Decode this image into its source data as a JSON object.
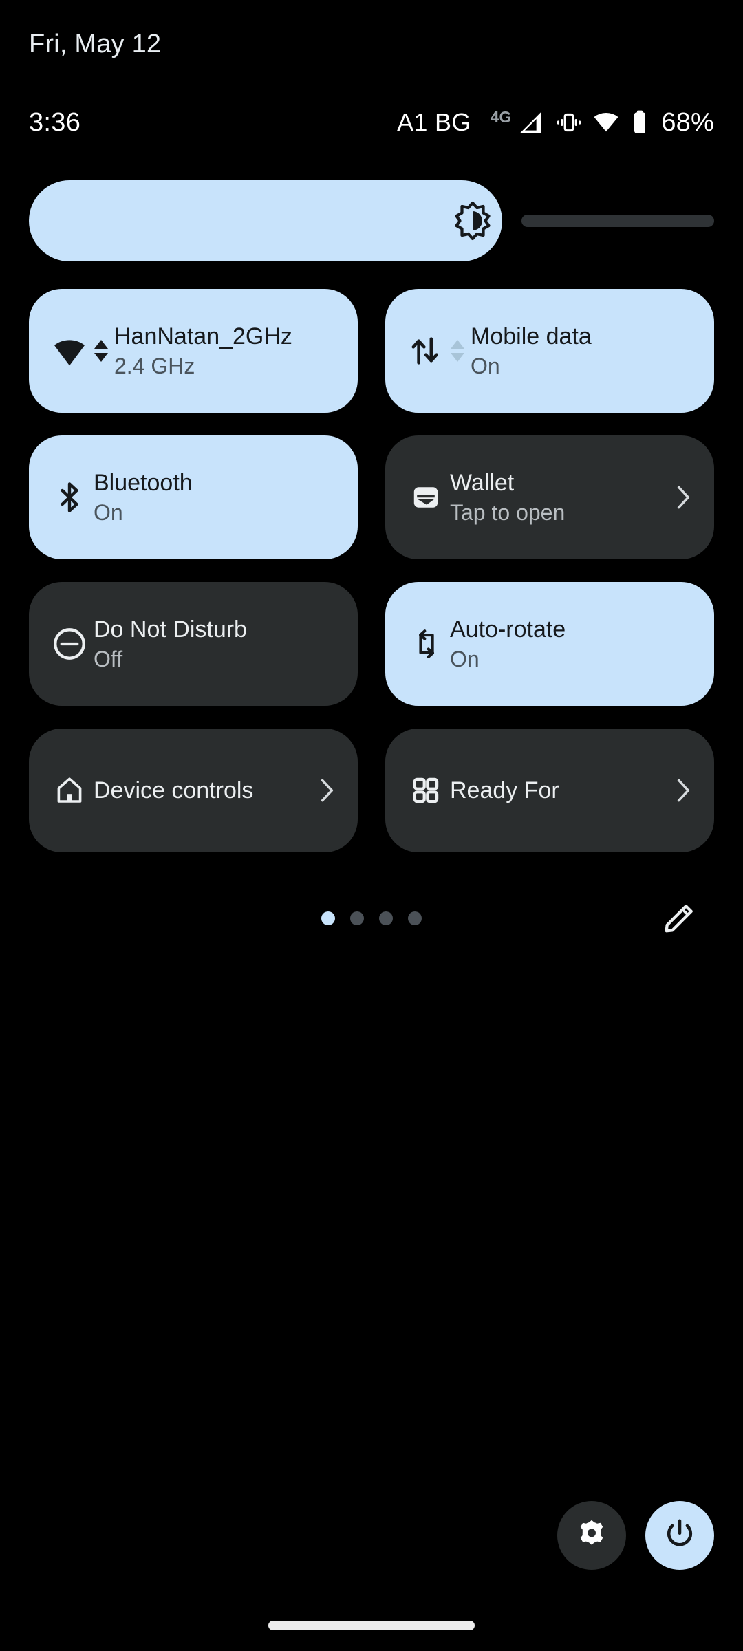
{
  "header": {
    "date": "Fri, May 12"
  },
  "status_bar": {
    "clock": "3:36",
    "carrier": "A1 BG",
    "network_type": "4G",
    "battery_percent": "68%",
    "icons": {
      "signal": "signal-bars-icon",
      "vibrate": "vibrate-icon",
      "wifi": "wifi-icon",
      "battery": "battery-icon"
    }
  },
  "brightness": {
    "name": "brightness-slider",
    "icon": "brightness-icon",
    "value_percent": 69
  },
  "tiles": [
    {
      "id": "wifi",
      "title": "HanNatan_2GHz",
      "subtitle": "2.4 GHz",
      "state": "active",
      "icon": "wifi-icon",
      "activity_arrows": "active",
      "chevron": false
    },
    {
      "id": "mobile-data",
      "title": "Mobile data",
      "subtitle": "On",
      "state": "active",
      "icon": "data-transfer-icon",
      "activity_arrows": "dim",
      "chevron": false
    },
    {
      "id": "bluetooth",
      "title": "Bluetooth",
      "subtitle": "On",
      "state": "active",
      "icon": "bluetooth-icon",
      "activity_arrows": "none",
      "chevron": false
    },
    {
      "id": "wallet",
      "title": "Wallet",
      "subtitle": "Tap to open",
      "state": "inactive",
      "icon": "wallet-icon",
      "activity_arrows": "none",
      "chevron": true
    },
    {
      "id": "do-not-disturb",
      "title": "Do Not Disturb",
      "subtitle": "Off",
      "state": "inactive",
      "icon": "do-not-disturb-icon",
      "activity_arrows": "none",
      "chevron": false
    },
    {
      "id": "auto-rotate",
      "title": "Auto-rotate",
      "subtitle": "On",
      "state": "active",
      "icon": "auto-rotate-icon",
      "activity_arrows": "none",
      "chevron": false
    },
    {
      "id": "device-controls",
      "title": "Device controls",
      "subtitle": "",
      "state": "inactive",
      "icon": "home-icon",
      "activity_arrows": "none",
      "chevron": true
    },
    {
      "id": "ready-for",
      "title": "Ready For",
      "subtitle": "",
      "state": "inactive",
      "icon": "grid-squares-icon",
      "activity_arrows": "none",
      "chevron": true
    }
  ],
  "pager": {
    "total_pages": 4,
    "current_page": 1,
    "edit_icon": "pencil-icon"
  },
  "footer": {
    "settings_icon": "gear-icon",
    "power_icon": "power-icon"
  },
  "colors": {
    "background": "#000000",
    "tile_active": "#c8e3fb",
    "tile_inactive": "#2a2d2e",
    "text_on_active": "#16191c",
    "text_on_inactive": "#eceff1"
  }
}
